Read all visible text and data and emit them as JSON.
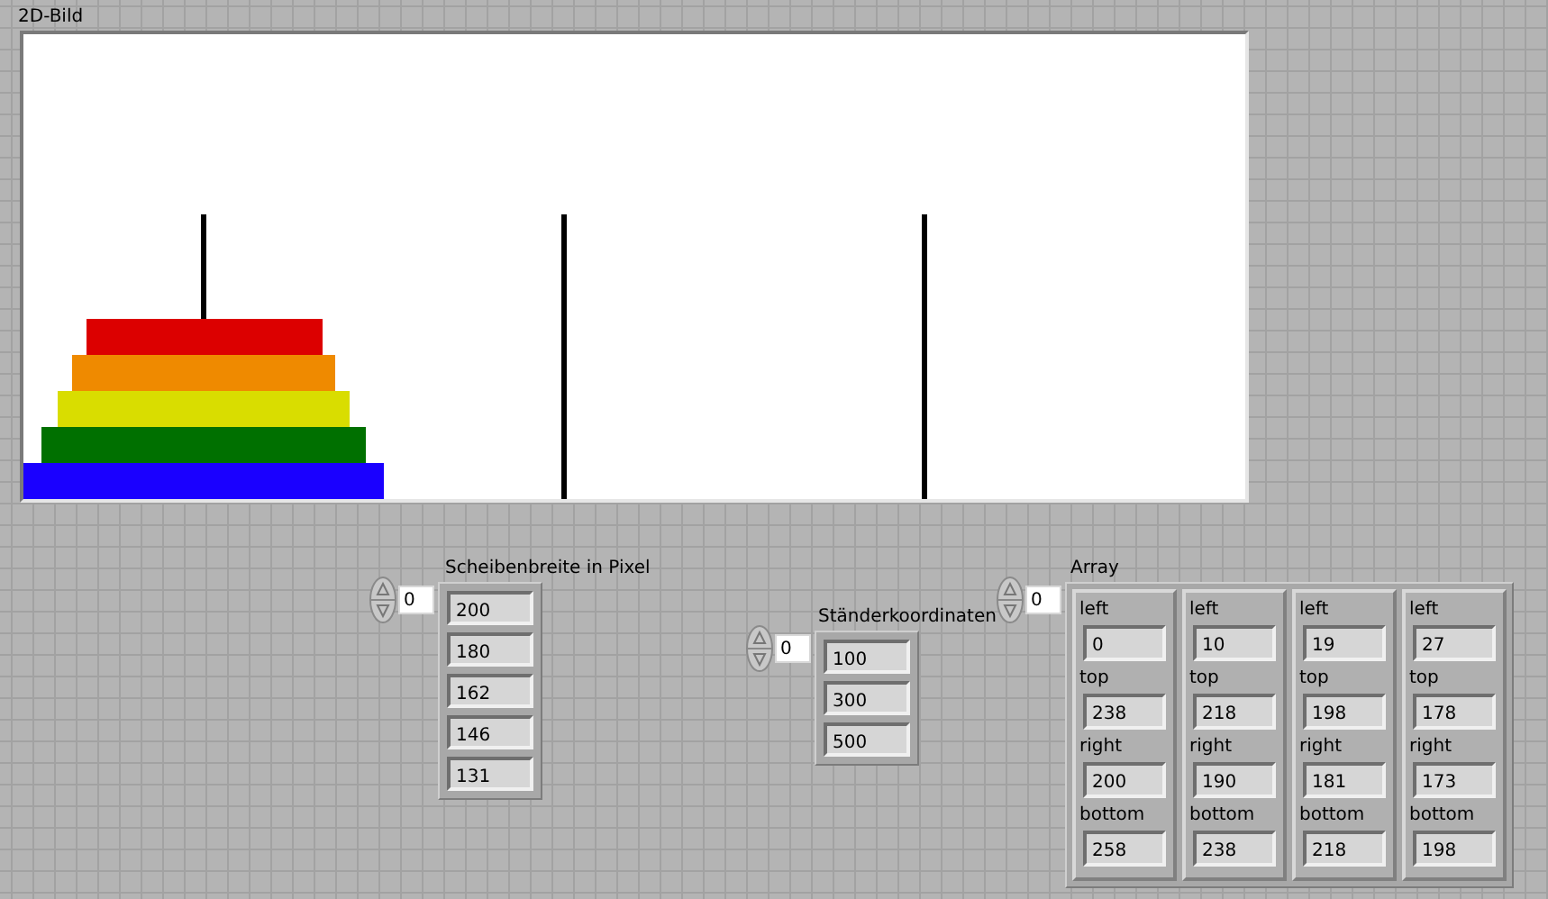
{
  "picture": {
    "label": "2D-Bild"
  },
  "disk_widths": {
    "label": "Scheibenbreite in Pixel",
    "index": "0",
    "values": [
      "200",
      "180",
      "162",
      "146",
      "131"
    ]
  },
  "peg_coordinates": {
    "label": "Ständerkoordinaten",
    "index": "0",
    "values": [
      "100",
      "300",
      "500"
    ]
  },
  "array": {
    "label": "Array",
    "index": "0",
    "elements": [
      {
        "fields": [
          {
            "label": "left",
            "value": "0"
          },
          {
            "label": "top",
            "value": "238"
          },
          {
            "label": "right",
            "value": "200"
          },
          {
            "label": "bottom",
            "value": "258"
          }
        ]
      },
      {
        "fields": [
          {
            "label": "left",
            "value": "10"
          },
          {
            "label": "top",
            "value": "218"
          },
          {
            "label": "right",
            "value": "190"
          },
          {
            "label": "bottom",
            "value": "238"
          }
        ]
      },
      {
        "fields": [
          {
            "label": "left",
            "value": "19"
          },
          {
            "label": "top",
            "value": "198"
          },
          {
            "label": "right",
            "value": "181"
          },
          {
            "label": "bottom",
            "value": "218"
          }
        ]
      },
      {
        "fields": [
          {
            "label": "left",
            "value": "27"
          },
          {
            "label": "top",
            "value": "178"
          },
          {
            "label": "right",
            "value": "173"
          },
          {
            "label": "bottom",
            "value": "198"
          }
        ]
      }
    ]
  }
}
